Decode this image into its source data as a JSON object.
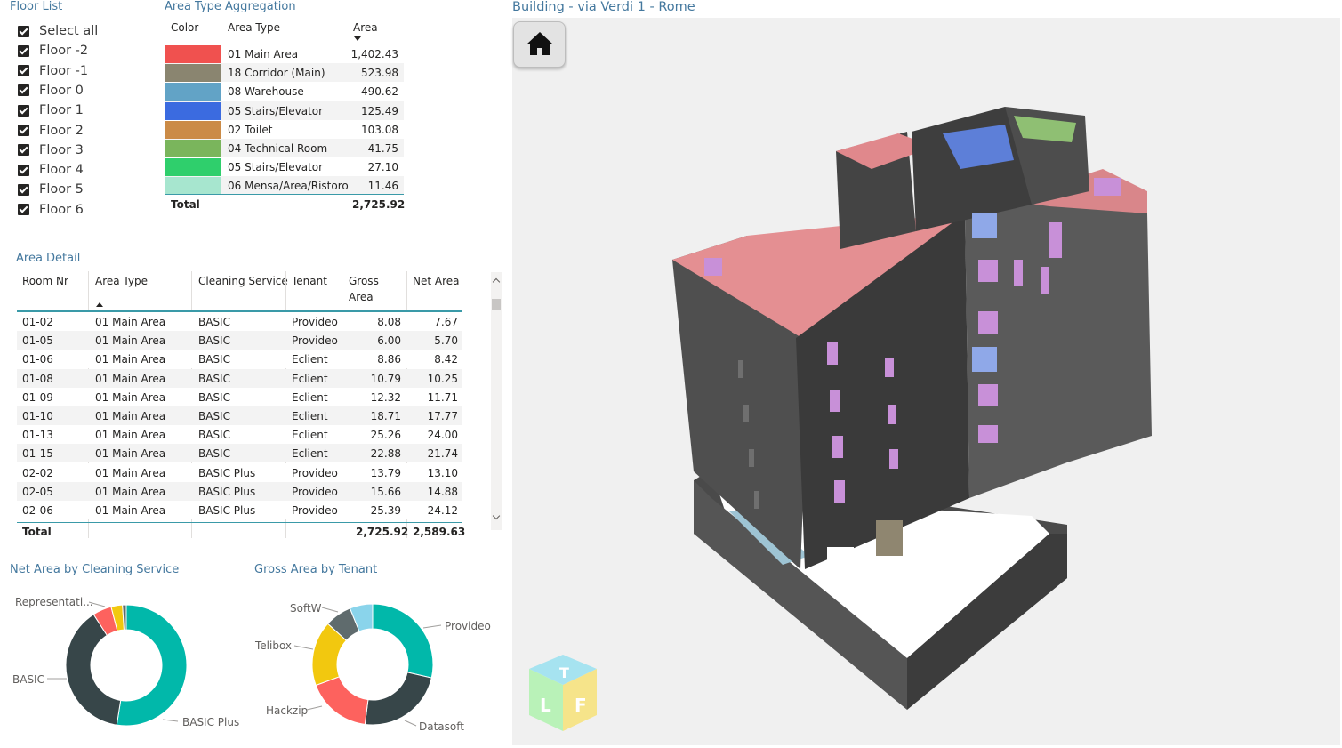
{
  "floor_list": {
    "title": "Floor List",
    "items": [
      "Select all",
      "Floor -2",
      "Floor -1",
      "Floor 0",
      "Floor 1",
      "Floor 2",
      "Floor 3",
      "Floor 4",
      "Floor 5",
      "Floor 6"
    ]
  },
  "area_type_aggregation": {
    "title": "Area Type Aggregation",
    "headers": {
      "color": "Color",
      "area_type": "Area Type",
      "area": "Area"
    },
    "rows": [
      {
        "color": "#f0514f",
        "area_type": "01 Main Area",
        "area": "1,402.43"
      },
      {
        "color": "#8a8570",
        "area_type": "18 Corridor (Main)",
        "area": "523.98"
      },
      {
        "color": "#62a3c6",
        "area_type": "08 Warehouse",
        "area": "490.62"
      },
      {
        "color": "#3b6be0",
        "area_type": "05 Stairs/Elevator",
        "area": "125.49"
      },
      {
        "color": "#cb8b47",
        "area_type": "02 Toilet",
        "area": "103.08"
      },
      {
        "color": "#7ab55c",
        "area_type": "04 Technical Room",
        "area": "41.75"
      },
      {
        "color": "#2fcf6c",
        "area_type": "05 Stairs/Elevator",
        "area": "27.10"
      },
      {
        "color": "#a7e6cf",
        "area_type": "06 Mensa/Area/Ristoro",
        "area": "11.46"
      }
    ],
    "total_label": "Total",
    "total_value": "2,725.92"
  },
  "area_detail": {
    "title": "Area Detail",
    "headers": {
      "room": "Room Nr",
      "area_type": "Area Type",
      "cleaning": "Cleaning Service",
      "tenant": "Tenant",
      "gross_1": "Gross",
      "gross_2": "Area",
      "net": "Net Area"
    },
    "rows": [
      {
        "room": "01-02",
        "area_type": "01 Main Area",
        "cleaning": "BASIC",
        "tenant": "Provideo",
        "gross": "8.08",
        "net": "7.67"
      },
      {
        "room": "01-05",
        "area_type": "01 Main Area",
        "cleaning": "BASIC",
        "tenant": "Provideo",
        "gross": "6.00",
        "net": "5.70"
      },
      {
        "room": "01-06",
        "area_type": "01 Main Area",
        "cleaning": "BASIC",
        "tenant": "Eclient",
        "gross": "8.86",
        "net": "8.42"
      },
      {
        "room": "01-08",
        "area_type": "01 Main Area",
        "cleaning": "BASIC",
        "tenant": "Eclient",
        "gross": "10.79",
        "net": "10.25"
      },
      {
        "room": "01-09",
        "area_type": "01 Main Area",
        "cleaning": "BASIC",
        "tenant": "Eclient",
        "gross": "12.32",
        "net": "11.71"
      },
      {
        "room": "01-10",
        "area_type": "01 Main Area",
        "cleaning": "BASIC",
        "tenant": "Eclient",
        "gross": "18.71",
        "net": "17.77"
      },
      {
        "room": "01-13",
        "area_type": "01 Main Area",
        "cleaning": "BASIC",
        "tenant": "Eclient",
        "gross": "25.26",
        "net": "24.00"
      },
      {
        "room": "01-15",
        "area_type": "01 Main Area",
        "cleaning": "BASIC",
        "tenant": "Eclient",
        "gross": "22.88",
        "net": "21.74"
      },
      {
        "room": "02-02",
        "area_type": "01 Main Area",
        "cleaning": "BASIC Plus",
        "tenant": "Provideo",
        "gross": "13.79",
        "net": "13.10"
      },
      {
        "room": "02-05",
        "area_type": "01 Main Area",
        "cleaning": "BASIC Plus",
        "tenant": "Provideo",
        "gross": "15.66",
        "net": "14.88"
      },
      {
        "room": "02-06",
        "area_type": "01 Main Area",
        "cleaning": "BASIC Plus",
        "tenant": "Provideo",
        "gross": "25.39",
        "net": "24.12"
      }
    ],
    "total_label": "Total",
    "total_gross": "2,725.92",
    "total_net": "2,589.63"
  },
  "chart_data": [
    {
      "type": "pie",
      "title": "Net Area by Cleaning Service",
      "categories": [
        "BASIC Plus",
        "BASIC",
        "Representati...",
        "(unlabeled yellow)",
        "(unlabeled gray)"
      ],
      "values": [
        52,
        38,
        5,
        3,
        1
      ],
      "colors": [
        "#01b8aa",
        "#374649",
        "#fd625e",
        "#f2c80f",
        "#5f6b6d"
      ],
      "labels_shown": [
        "BASIC Plus",
        "BASIC",
        "Representati..."
      ]
    },
    {
      "type": "pie",
      "title": "Gross Area by Tenant",
      "categories": [
        "Provideo",
        "Datasoft",
        "Hackzip",
        "Telibox",
        "SoftW",
        "(unlabeled light blue)"
      ],
      "values": [
        28,
        23,
        17,
        17,
        7,
        6
      ],
      "colors": [
        "#01b8aa",
        "#374649",
        "#fd625e",
        "#f2c80f",
        "#5f6b6d",
        "#8ad4eb"
      ],
      "labels_shown": [
        "Provideo",
        "Datasoft",
        "Hackzip",
        "Telibox",
        "SoftW"
      ]
    }
  ],
  "building": {
    "title": "Building - via Verdi 1 - Rome",
    "home_icon": "home-icon",
    "cube_letters": [
      "T",
      "L",
      "F"
    ]
  }
}
